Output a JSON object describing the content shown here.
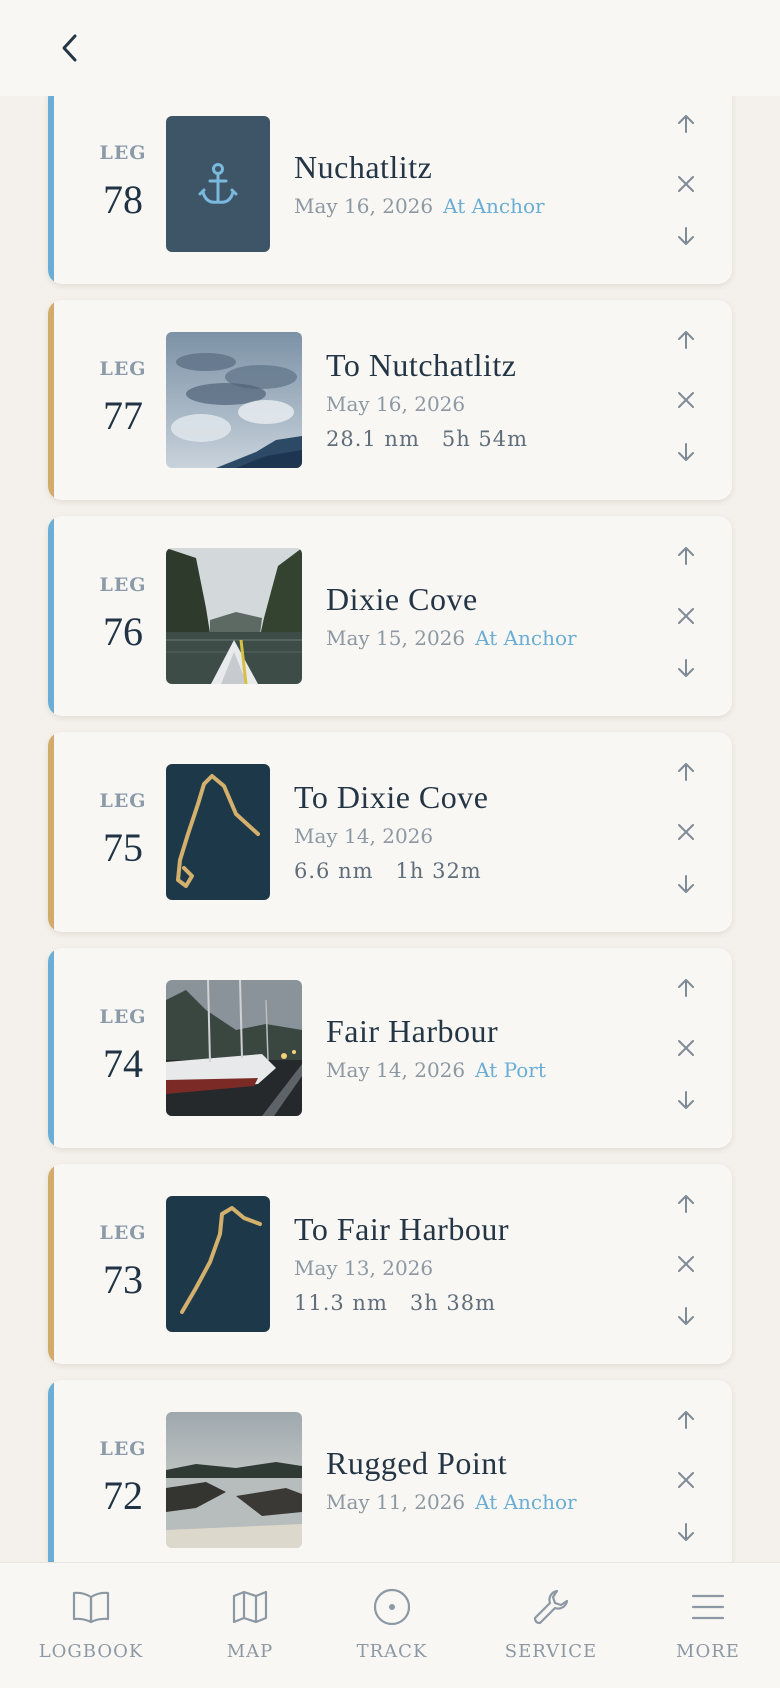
{
  "header": {
    "back_icon": "chevron-left-icon"
  },
  "legs": [
    {
      "label": "LEG",
      "number": "78",
      "title": "Nuchatlitz",
      "date": "May 16, 2026",
      "status": "At Anchor",
      "type": "anchor",
      "thumb": "anchor-icon"
    },
    {
      "label": "LEG",
      "number": "77",
      "title": "To Nutchatlitz",
      "date": "May 16, 2026",
      "distance": "28.1 nm",
      "duration": "5h 54m",
      "type": "passage",
      "thumb": "cloudy-sky-photo"
    },
    {
      "label": "LEG",
      "number": "76",
      "title": "Dixie Cove",
      "date": "May 15, 2026",
      "status": "At Anchor",
      "type": "anchor",
      "thumb": "kayak-cove-photo"
    },
    {
      "label": "LEG",
      "number": "75",
      "title": "To Dixie Cove",
      "date": "May 14, 2026",
      "distance": "6.6 nm",
      "duration": "1h 32m",
      "type": "passage",
      "thumb": "track-map"
    },
    {
      "label": "LEG",
      "number": "74",
      "title": "Fair Harbour",
      "date": "May 14, 2026",
      "status": "At Port",
      "type": "anchor",
      "thumb": "marina-photo"
    },
    {
      "label": "LEG",
      "number": "73",
      "title": "To Fair Harbour",
      "date": "May 13, 2026",
      "distance": "11.3 nm",
      "duration": "3h 38m",
      "type": "passage",
      "thumb": "track-map"
    },
    {
      "label": "LEG",
      "number": "72",
      "title": "Rugged Point",
      "date": "May 11, 2026",
      "status": "At Anchor",
      "type": "anchor",
      "thumb": "beach-photo"
    }
  ],
  "nav": [
    {
      "label": "LOGBOOK",
      "icon": "book-icon"
    },
    {
      "label": "MAP",
      "icon": "map-icon"
    },
    {
      "label": "TRACK",
      "icon": "track-icon"
    },
    {
      "label": "SERVICE",
      "icon": "wrench-icon"
    },
    {
      "label": "MORE",
      "icon": "menu-icon"
    }
  ],
  "colors": {
    "anchor_accent": "#6aaed6",
    "passage_accent": "#d2aa6a",
    "track_line": "#d4b06d",
    "thumb_dark": "#1d3949",
    "anchor_thumb": "#3d5566"
  }
}
